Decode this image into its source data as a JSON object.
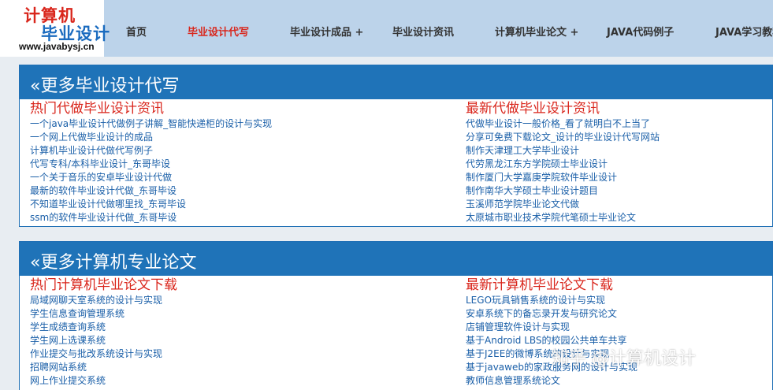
{
  "logo": {
    "line1": "计算机",
    "line2": "毕业设计",
    "url": "www.javabysj.cn"
  },
  "nav": [
    {
      "label": "首页",
      "active": false
    },
    {
      "label": "毕业设计代写",
      "active": true
    },
    {
      "label": "毕业设计成品 +",
      "active": false
    },
    {
      "label": "毕业设计资讯",
      "active": false
    },
    {
      "label": "计算机毕业论文 +",
      "active": false
    },
    {
      "label": "JAVA代码例子",
      "active": false
    },
    {
      "label": "JAVA学习教程",
      "active": false
    }
  ],
  "sections": [
    {
      "title": "«更多毕业设计代写",
      "left": {
        "title": "热门代做毕业设计资讯",
        "links": [
          "一个java毕业设计代做例子讲解_智能快递柜的设计与实现",
          "一个网上代做毕业设计的成品",
          "计算机毕业设计代做代写例子",
          "代写专科/本科毕业设计_东哥毕设",
          "一个关于音乐的安卓毕业设计代做",
          "最新的软件毕业设计代做_东哥毕设",
          "不知道毕业设计代做哪里找_东哥毕设",
          "ssm的软件毕业设计代做_东哥毕设"
        ]
      },
      "right": {
        "title": "最新代做毕业设计资讯",
        "links": [
          "代做毕业设计一般价格_看了就明白不上当了",
          "分享可免费下载论文_设计的毕业设计代写网站",
          "制作天津理工大学毕业设计",
          "代劳黑龙江东方学院硕士毕业设计",
          "制作厦门大学嘉庚学院软件毕业设计",
          "制作南华大学硕士毕业设计题目",
          "玉溪师范学院毕业论文代做",
          "太原城市职业技术学院代笔硕士毕业论文"
        ]
      }
    },
    {
      "title": "«更多计算机专业论文",
      "left": {
        "title": "热门计算机毕业论文下载",
        "links": [
          "局域网聊天室系统的设计与实现",
          "学生信息查询管理系统",
          "学生成绩查询系统",
          "学生网上选课系统",
          "作业提交与批改系统设计与实现",
          "招聘网站系统",
          "网上作业提交系统"
        ]
      },
      "right": {
        "title": "最新计算机毕业论文下载",
        "links": [
          "LEGO玩具销售系统的设计与实现",
          "安卓系统下的备忘录开发与研究论文",
          "店铺管理软件设计与实现",
          "基于Android LBS的校园公共单车共享",
          "基于J2EE的微博系统的设计与实现",
          "基于javaweb的家政服务网的设计与实现",
          "教师信息管理系统论文"
        ]
      }
    }
  ],
  "watermark": "知乎 @计算机设计"
}
